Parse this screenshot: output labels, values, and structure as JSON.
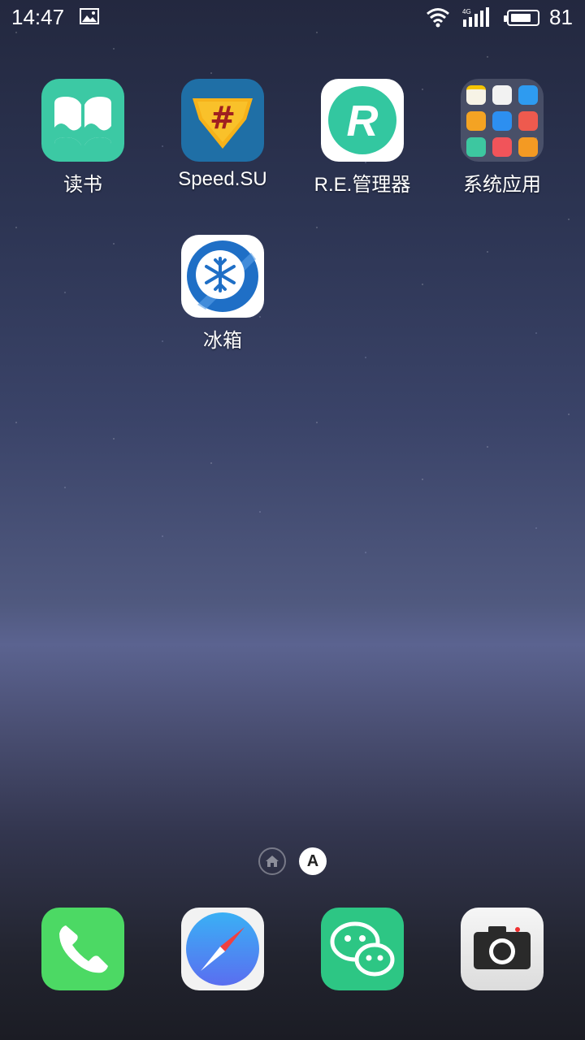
{
  "status_bar": {
    "time": "14:47",
    "network_label": "4G",
    "battery_level": "81",
    "battery_fraction": 0.81
  },
  "apps": [
    {
      "label": "读书",
      "icon": "book-icon"
    },
    {
      "label": "Speed.SU",
      "icon": "superuser-hash-icon"
    },
    {
      "label": "R.E.管理器",
      "icon": "re-manager-icon"
    },
    {
      "label": "系统应用",
      "icon": "folder-icon"
    },
    {
      "label": "冰箱",
      "icon": "snowflake-icon"
    }
  ],
  "page_indicator": {
    "home_icon": "home-icon",
    "current_page_label": "A"
  },
  "dock": [
    {
      "icon": "phone-icon",
      "color": "#4cd964"
    },
    {
      "icon": "compass-icon",
      "color": "#4a90f0"
    },
    {
      "icon": "wechat-icon",
      "color": "#2dc684"
    },
    {
      "icon": "camera-icon",
      "color": "#e6e6e6"
    }
  ]
}
